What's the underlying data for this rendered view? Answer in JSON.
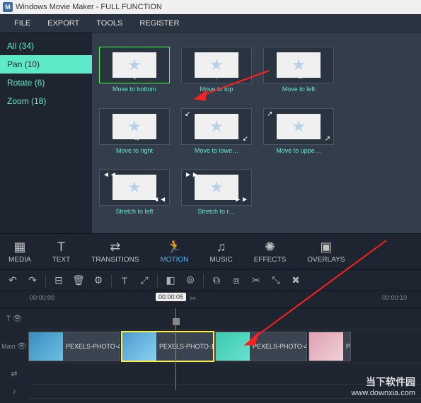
{
  "titlebar": {
    "icon_letter": "M",
    "text": "Windows Movie Maker - FULL FUNCTION"
  },
  "menubar": [
    "FILE",
    "EXPORT",
    "TOOLS",
    "REGISTER"
  ],
  "sidebar": {
    "items": [
      {
        "label": "All (34)",
        "selected": false
      },
      {
        "label": "Pan (10)",
        "selected": true
      },
      {
        "label": "Rotate (6)",
        "selected": false
      },
      {
        "label": "Zoom (18)",
        "selected": false
      }
    ]
  },
  "effects": [
    {
      "label": "Move to bottom",
      "selected": true,
      "arrow": "↓"
    },
    {
      "label": "Move to top",
      "selected": false,
      "arrow": "↑"
    },
    {
      "label": "Move to left",
      "selected": false,
      "arrow": "←"
    },
    {
      "label": "Move to right",
      "selected": false,
      "arrow": "→"
    },
    {
      "label": "Move to lowe…",
      "selected": false,
      "arrow": "↙"
    },
    {
      "label": "Move to uppe…",
      "selected": false,
      "arrow": "↗"
    },
    {
      "label": "Stretch to left",
      "selected": false,
      "arrow": "◄◄"
    },
    {
      "label": "Stretch to r…",
      "selected": false,
      "arrow": "►►"
    }
  ],
  "tabs": [
    {
      "label": "MEDIA",
      "icon": "▦",
      "active": false
    },
    {
      "label": "TEXT",
      "icon": "T",
      "active": false
    },
    {
      "label": "TRANSITIONS",
      "icon": "⇄",
      "active": false
    },
    {
      "label": "MOTION",
      "icon": "🏃",
      "active": true
    },
    {
      "label": "MUSIC",
      "icon": "♫",
      "active": false
    },
    {
      "label": "EFFECTS",
      "icon": "✺",
      "active": false
    },
    {
      "label": "OVERLAYS",
      "icon": "▣",
      "active": false
    }
  ],
  "toolbar_icons": [
    "↶",
    "↷",
    "|",
    "⊟",
    "🗑",
    "⚙",
    "|",
    "T",
    "⤢",
    "|",
    "◧",
    "⦾",
    "|",
    "⧉",
    "⧈",
    "✂",
    "⤡",
    "✖"
  ],
  "time_labels": [
    "00:00:00",
    "00:00:10"
  ],
  "playhead_time": "00:00:05",
  "tracks": {
    "text": "T",
    "main": "Main"
  },
  "clips": [
    {
      "label": "PEXELS-PHOTO-4",
      "selected": false,
      "thumb": "t1"
    },
    {
      "label": "PEXELS-PHOTO-1",
      "selected": true,
      "thumb": "t2"
    },
    {
      "label": "PEXELS-PHOTO-4",
      "selected": false,
      "thumb": "t3"
    },
    {
      "label": "PE",
      "selected": false,
      "thumb": "t4"
    }
  ],
  "watermark": {
    "brand": "当下软件园",
    "url": "www.downxia.com"
  }
}
